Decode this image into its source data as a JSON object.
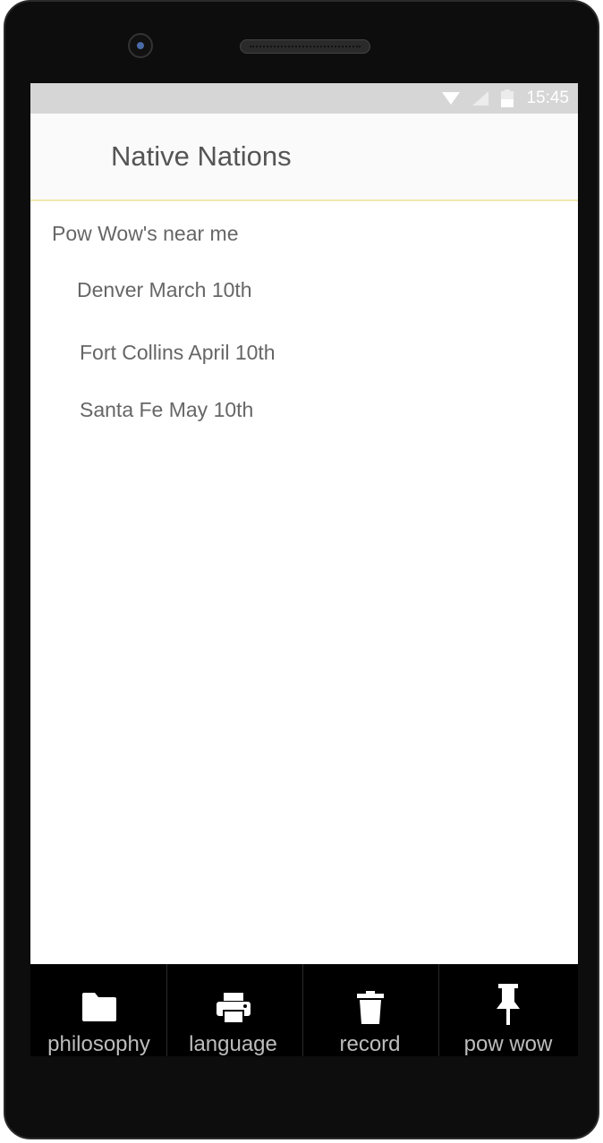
{
  "status": {
    "time": "15:45"
  },
  "app": {
    "title": "Native Nations"
  },
  "section": {
    "title": "Pow Wow's near me"
  },
  "events": [
    {
      "label": "Denver March 10th"
    },
    {
      "label": "Fort Collins April 10th"
    },
    {
      "label": "Santa Fe May 10th"
    }
  ],
  "nav": [
    {
      "label": "philosophy",
      "icon": "folder-icon"
    },
    {
      "label": "language",
      "icon": "printer-icon"
    },
    {
      "label": "record",
      "icon": "trash-icon"
    },
    {
      "label": "pow wow",
      "icon": "pin-icon"
    }
  ]
}
